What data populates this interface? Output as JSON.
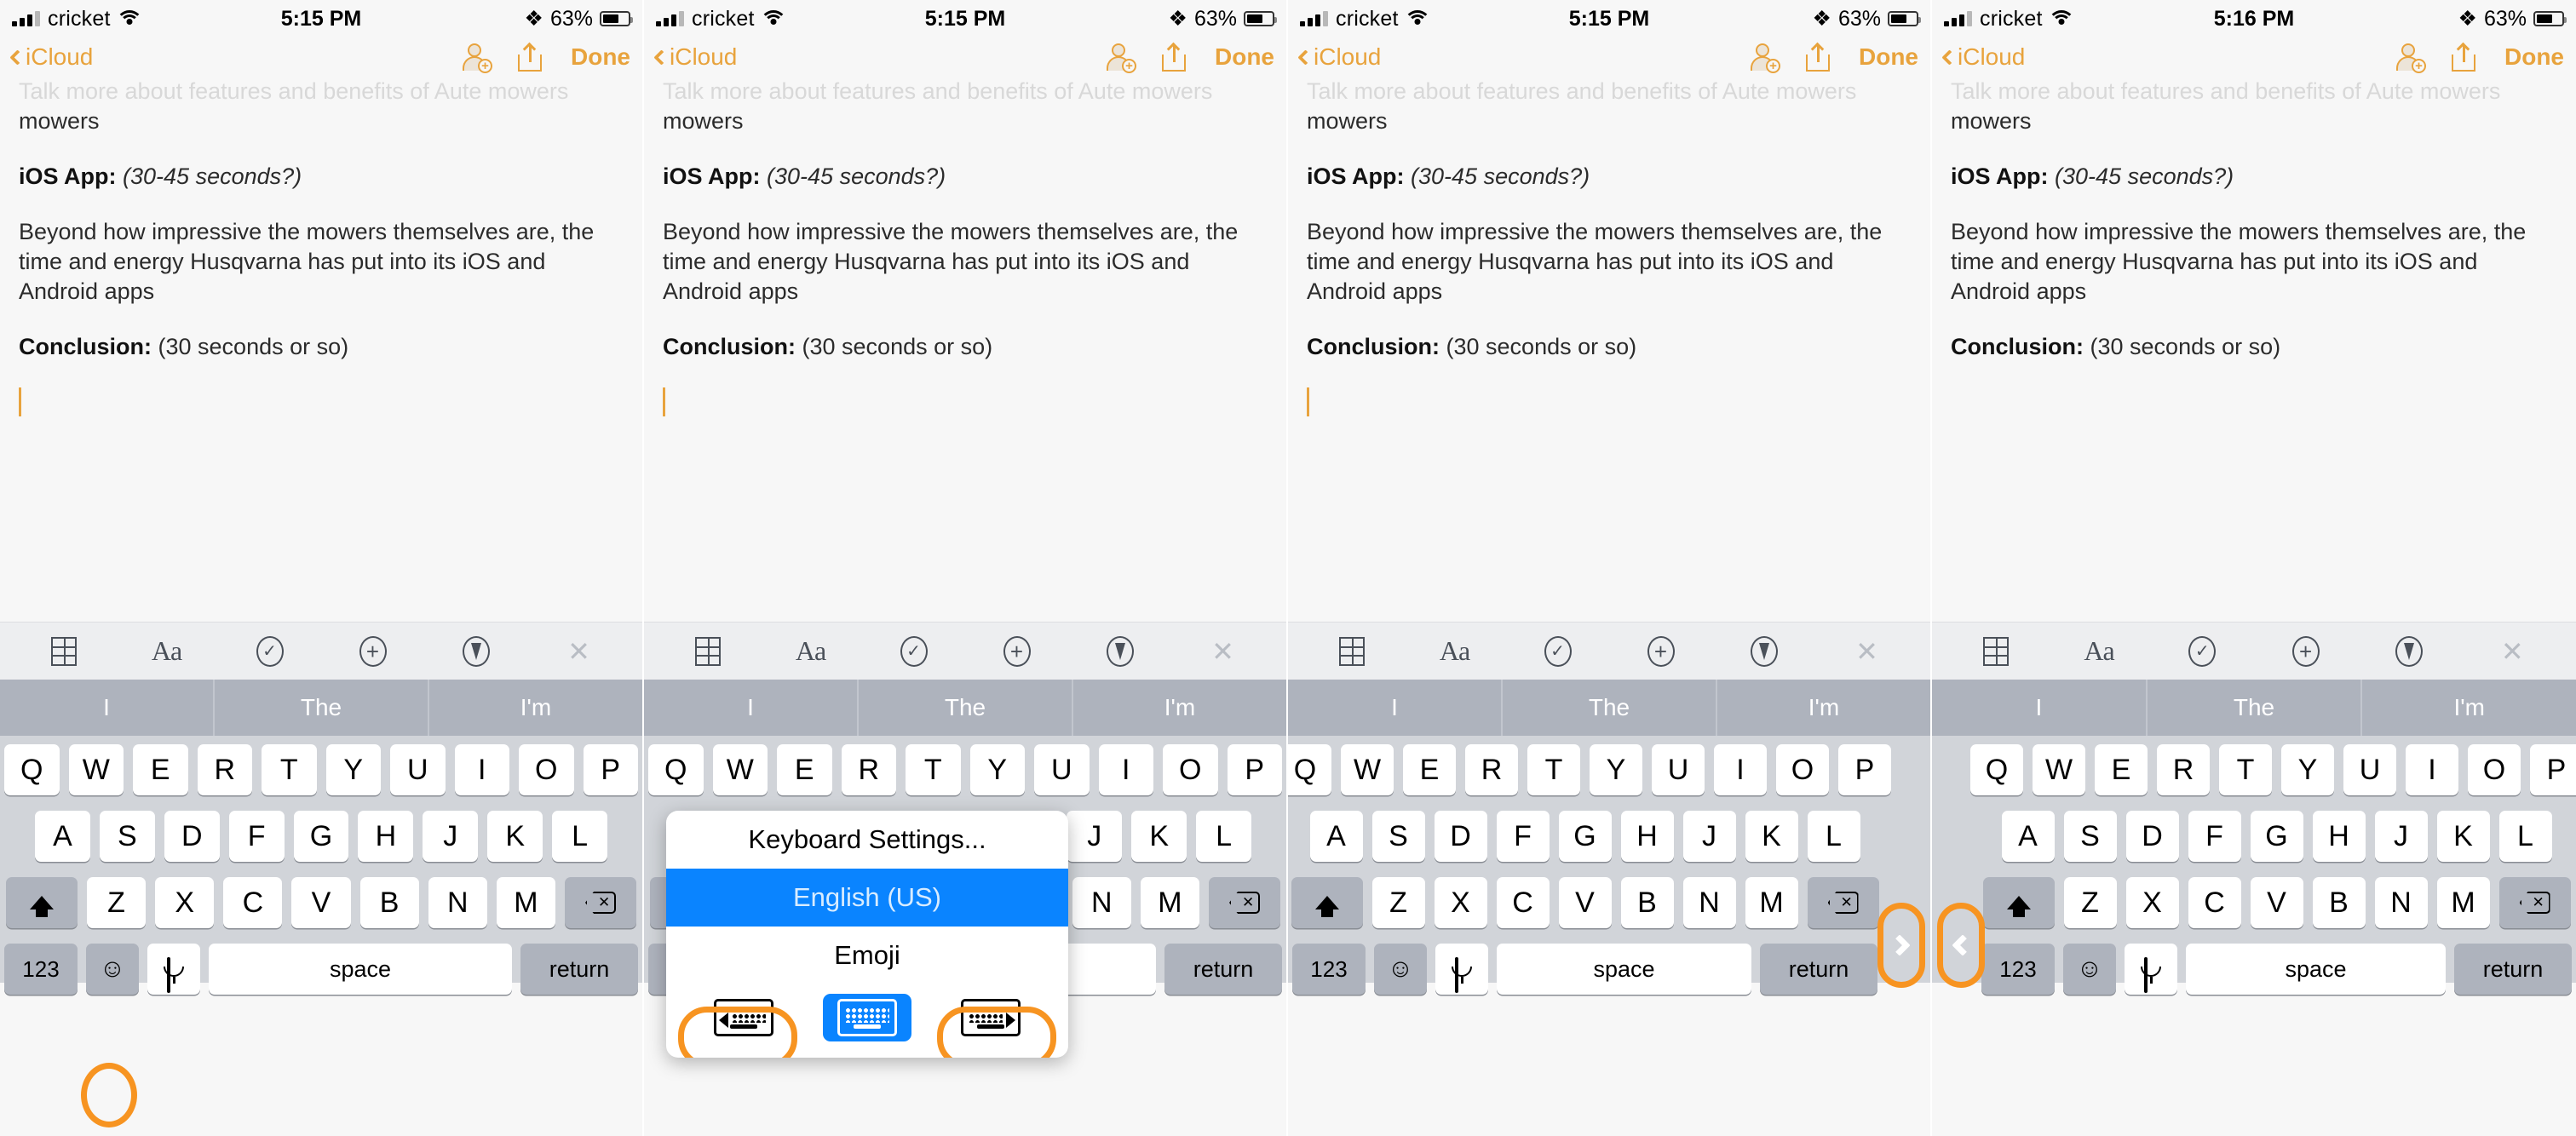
{
  "panels": [
    {
      "id": "panel-1",
      "status": {
        "carrier": "cricket",
        "time": "5:15 PM",
        "battery": "63%"
      },
      "nav": {
        "back": "iCloud",
        "done": "Done"
      },
      "note": {
        "faded": "Talk more about features and benefits of Aute mowers",
        "line_tail": "mowers",
        "heading1": "iOS App:",
        "heading1_note": "(30-45 seconds?)",
        "body": "Beyond how impressive the mowers themselves are, the time and energy Husqvarna has put into its iOS and Android apps",
        "heading2": "Conclusion:",
        "heading2_note": "(30 seconds or so)"
      },
      "predictions": [
        "I",
        "The",
        "I'm"
      ],
      "highlight": "emoji-key"
    },
    {
      "id": "panel-2",
      "status": {
        "carrier": "cricket",
        "time": "5:15 PM",
        "battery": "63%"
      },
      "nav": {
        "back": "iCloud",
        "done": "Done"
      },
      "note": {
        "faded": "Talk more about features and benefits of Aute mowers",
        "line_tail": "mowers",
        "heading1": "iOS App:",
        "heading1_note": "(30-45 seconds?)",
        "body": "Beyond how impressive the mowers themselves are, the time and energy Husqvarna has put into its iOS and Android apps",
        "heading2": "Conclusion:",
        "heading2_note": "(30 seconds or so)"
      },
      "predictions": [
        "I",
        "The",
        "I'm"
      ],
      "popup": {
        "settings_label": "Keyboard Settings...",
        "selected_label": "English (US)",
        "emoji_label": "Emoji",
        "buttons": [
          "float-left-keyboard-icon",
          "full-keyboard-icon",
          "float-right-keyboard-icon"
        ]
      },
      "highlight": "popup-side-keyboard-buttons"
    },
    {
      "id": "panel-3",
      "status": {
        "carrier": "cricket",
        "time": "5:15 PM",
        "battery": "63%"
      },
      "nav": {
        "back": "iCloud",
        "done": "Done"
      },
      "note": {
        "faded": "Talk more about features and benefits of Aute mowers",
        "line_tail": "mowers",
        "heading1": "iOS App:",
        "heading1_note": "(30-45 seconds?)",
        "body": "Beyond how impressive the mowers themselves are, the time and energy Husqvarna has put into its iOS and Android apps",
        "heading2": "Conclusion:",
        "heading2_note": "(30 seconds or so)"
      },
      "predictions": [
        "I",
        "The",
        "I'm"
      ],
      "highlight": "right-edge-expand-chevron"
    },
    {
      "id": "panel-4",
      "status": {
        "carrier": "cricket",
        "time": "5:16 PM",
        "battery": "63%"
      },
      "nav": {
        "back": "iCloud",
        "done": "Done"
      },
      "note": {
        "faded": "Talk more about features and benefits of Aute mowers",
        "line_tail": "mowers",
        "heading1": "iOS App:",
        "heading1_note": "(30-45 seconds?)",
        "body": "Beyond how impressive the mowers themselves are, the time and energy Husqvarna has put into its iOS and Android apps",
        "heading2": "Conclusion:",
        "heading2_note": "(30 seconds or so)"
      },
      "predictions": [
        "I",
        "The",
        "I'm"
      ],
      "highlight": "left-edge-expand-chevron"
    }
  ],
  "toolbar": {
    "items": [
      "table-icon",
      "text-format-icon",
      "checklist-icon",
      "add-attachment-icon",
      "markup-pen-icon",
      "close-icon"
    ]
  },
  "keyboard": {
    "row1": [
      "Q",
      "W",
      "E",
      "R",
      "T",
      "Y",
      "U",
      "I",
      "O",
      "P"
    ],
    "row2": [
      "A",
      "S",
      "D",
      "F",
      "G",
      "H",
      "J",
      "K",
      "L"
    ],
    "row3": [
      "Z",
      "X",
      "C",
      "V",
      "B",
      "N",
      "M"
    ],
    "numeric_label": "123",
    "space_label": "space",
    "return_label": "return",
    "shift_icon": "shift-icon",
    "delete_icon": "delete-icon",
    "emoji_icon": "emoji-icon",
    "mic_icon": "microphone-icon"
  },
  "colors": {
    "accent": "#e8a33d",
    "highlight": "#f79421",
    "selected_blue": "#0a84ff",
    "keyboard_bg": "#d1d4d9",
    "predictive_bg": "#aeb3bd"
  }
}
